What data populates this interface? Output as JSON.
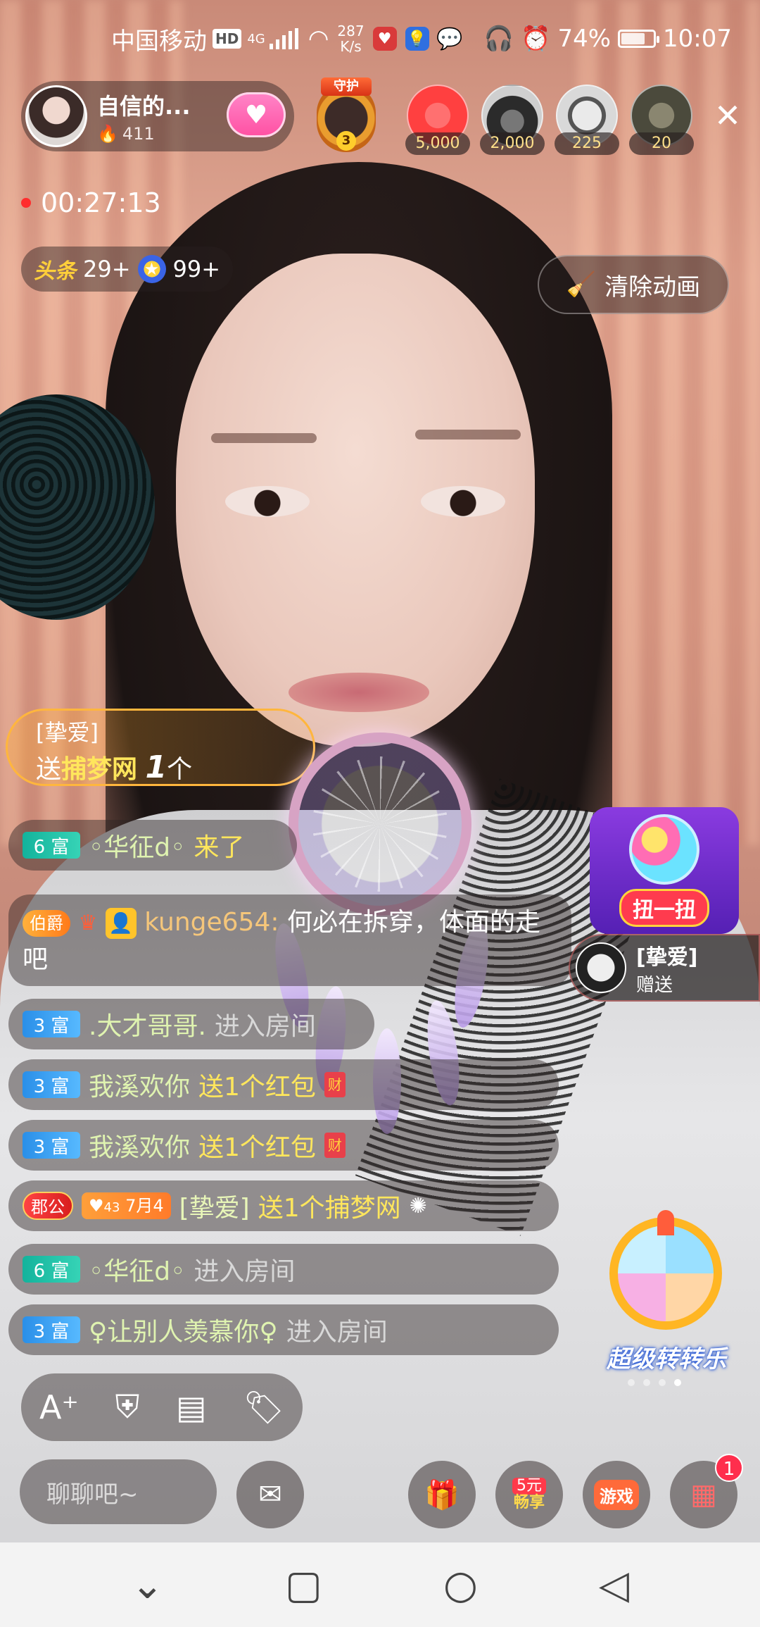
{
  "status_bar": {
    "carrier": "中国移动",
    "hd": "HD",
    "network": "4G",
    "speed_value": "287",
    "speed_unit": "K/s",
    "battery": "74%",
    "battery_level": 0.74,
    "time": "10:07"
  },
  "host": {
    "name": "自信的...",
    "heat": "411",
    "follow_icon": "heart-icon"
  },
  "guard": {
    "tag": "守护",
    "level": "3"
  },
  "viewers": [
    {
      "count": "5,000",
      "color": "#ff4040"
    },
    {
      "count": "2,000",
      "color": "#2b2b2b"
    },
    {
      "count": "225",
      "color": "#d9d9d9"
    },
    {
      "count": "20",
      "color": "#4b4a3c"
    }
  ],
  "live_timer": "00:27:13",
  "rank": {
    "headline_label": "头条",
    "headline_count": "29+",
    "star_count": "99+"
  },
  "clear_animation": "清除动画",
  "gift_toast": {
    "from": "[挚爱]",
    "prefix": "送",
    "gift": "捕梦网",
    "count": "1",
    "unit": "个"
  },
  "chat": {
    "join_1": {
      "level": "6 富",
      "name": "◦华征d◦",
      "action": "来了"
    },
    "big": {
      "title_badge": "伯爵",
      "name": "kunge654:",
      "text": "何必在拆穿，体面的走吧"
    },
    "rows": [
      {
        "level": "3 富",
        "name": ".大才哥哥.",
        "action": "进入房间",
        "gift": "",
        "tone": "blue"
      },
      {
        "level": "3 富",
        "name": "我溪欢你",
        "action": "",
        "gift": "送1个红包",
        "tone": "blue"
      },
      {
        "level": "3 富",
        "name": "我溪欢你",
        "action": "",
        "gift": "送1个红包",
        "tone": "blue"
      }
    ],
    "gift_row": {
      "badge": "郡公",
      "heart_level": "43",
      "date": "7月4",
      "name": "[挚爱]",
      "gift": "送1个捕梦网"
    },
    "tail_rows": [
      {
        "level": "6 富",
        "name": "◦华征d◦",
        "action": "进入房间",
        "tone": "teal"
      },
      {
        "level": "3 富",
        "name": "♀让别人羡慕你♀",
        "action": "进入房间",
        "tone": "blue"
      }
    ]
  },
  "twist": {
    "label": "扭一扭"
  },
  "sender": {
    "name": "[挚爱]",
    "action": "赠送"
  },
  "wheel": {
    "label": "超级转转乐"
  },
  "toolbar": {
    "icons": [
      "font-size-icon",
      "guard-icon",
      "record-icon",
      "tag-icon"
    ]
  },
  "bottom": {
    "input_placeholder": "聊聊吧~",
    "promo_line1": "5元",
    "promo_line2": "畅享",
    "game_label": "游戏",
    "menu_badge": "1"
  }
}
